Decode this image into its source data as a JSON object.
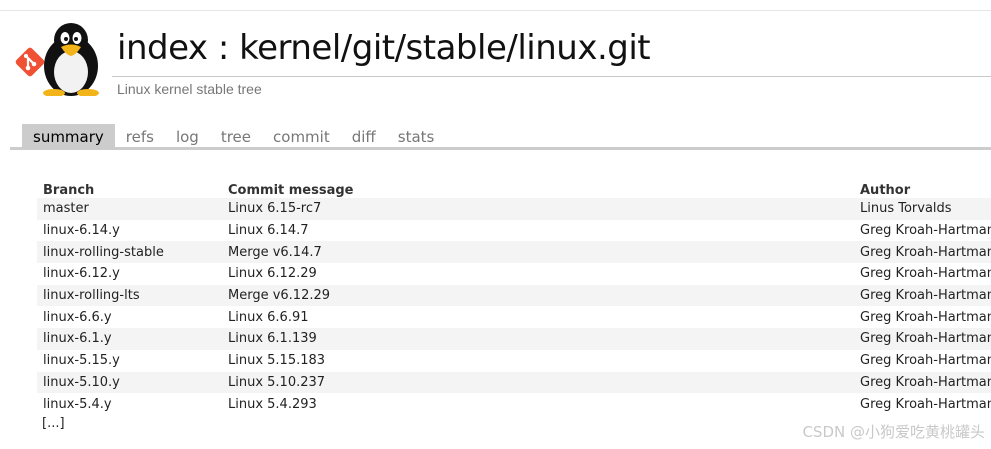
{
  "header": {
    "title": "index : kernel/git/stable/linux.git",
    "description": "Linux kernel stable tree"
  },
  "tabs": [
    {
      "label": "summary",
      "active": true
    },
    {
      "label": "refs"
    },
    {
      "label": "log"
    },
    {
      "label": "tree"
    },
    {
      "label": "commit"
    },
    {
      "label": "diff"
    },
    {
      "label": "stats"
    }
  ],
  "table": {
    "columns": [
      "Branch",
      "Commit message",
      "Author"
    ],
    "rows": [
      [
        "master",
        "Linux 6.15-rc7",
        "Linus Torvalds"
      ],
      [
        "linux-6.14.y",
        "Linux 6.14.7",
        "Greg Kroah-Hartman"
      ],
      [
        "linux-rolling-stable",
        "Merge v6.14.7",
        "Greg Kroah-Hartman"
      ],
      [
        "linux-6.12.y",
        "Linux 6.12.29",
        "Greg Kroah-Hartman"
      ],
      [
        "linux-rolling-lts",
        "Merge v6.12.29",
        "Greg Kroah-Hartman"
      ],
      [
        "linux-6.6.y",
        "Linux 6.6.91",
        "Greg Kroah-Hartman"
      ],
      [
        "linux-6.1.y",
        "Linux 6.1.139",
        "Greg Kroah-Hartman"
      ],
      [
        "linux-5.15.y",
        "Linux 5.15.183",
        "Greg Kroah-Hartman"
      ],
      [
        "linux-5.10.y",
        "Linux 5.10.237",
        "Greg Kroah-Hartman"
      ],
      [
        "linux-5.4.y",
        "Linux 5.4.293",
        "Greg Kroah-Hartman"
      ]
    ],
    "more_label": "[...]"
  },
  "watermark": "CSDN @小狗爱吃黄桃罐头",
  "colors": {
    "git_logo": "#f05033",
    "tab_active_bg": "#cccccc",
    "row_stripe": "#f4f4f4"
  }
}
